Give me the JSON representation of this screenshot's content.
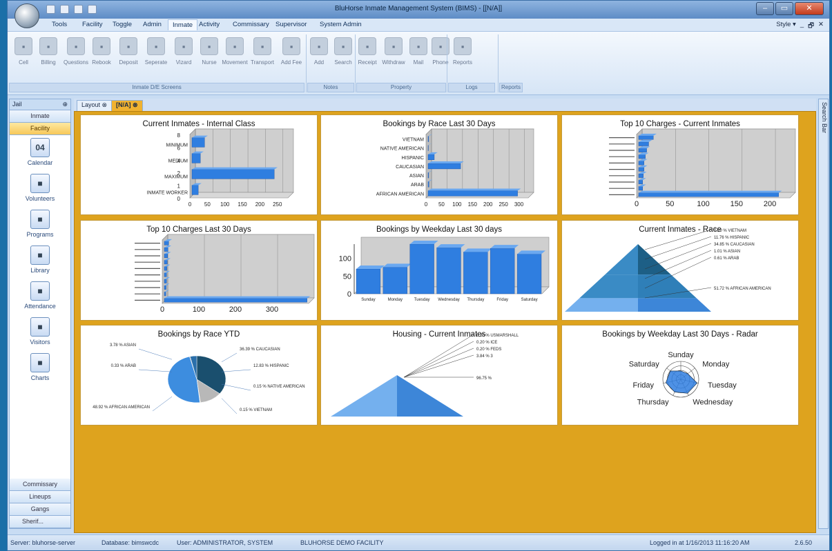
{
  "window": {
    "title": "BluHorse Inmate Management System (BIMS) - [[N/A]]"
  },
  "menu": {
    "items": [
      "Tools",
      "Facility",
      "Toggle",
      "Admin",
      "Inmate",
      "Activity",
      "Commissary",
      "Supervisor",
      "System Admin"
    ],
    "active": "Inmate",
    "style_label": "Style"
  },
  "ribbon": {
    "buttons": [
      {
        "label": "Cell",
        "icon": "cell-icon"
      },
      {
        "label": "Billing",
        "icon": "home-icon"
      },
      {
        "label": "Questions",
        "icon": "pen-icon"
      },
      {
        "label": "Rebook",
        "icon": "rebook-icon"
      },
      {
        "label": "Deposit",
        "icon": "deposit-icon"
      },
      {
        "label": "Seperate",
        "icon": "people-icon"
      },
      {
        "label": "Vizard",
        "icon": "wizard-icon"
      },
      {
        "label": "Nurse",
        "icon": "nurse-icon"
      },
      {
        "label": "Movement",
        "icon": "movement-icon"
      },
      {
        "label": "Transport",
        "icon": "transport-icon"
      },
      {
        "label": "Add Fee",
        "icon": "fee-icon"
      },
      {
        "label": "Add",
        "icon": "note-add-icon"
      },
      {
        "label": "Search",
        "icon": "note-search-icon"
      },
      {
        "label": "Receipt",
        "icon": "receipt-icon"
      },
      {
        "label": "Withdraw",
        "icon": "withdraw-icon"
      },
      {
        "label": "Mail",
        "icon": "mail-icon"
      },
      {
        "label": "Phone",
        "icon": "phone-icon"
      },
      {
        "label": "Reports",
        "icon": "reports-icon"
      }
    ],
    "groups": [
      "Inmate D/E Screens",
      "Notes",
      "Property",
      "Logs",
      "Reports"
    ]
  },
  "sidebar": {
    "header": "Jail",
    "top_nav": [
      "Inmate",
      "Facility"
    ],
    "selected": "Facility",
    "items": [
      {
        "label": "Calendar",
        "icon": "calendar-icon",
        "badge": "04"
      },
      {
        "label": "Volunteers",
        "icon": "volunteers-icon"
      },
      {
        "label": "Programs",
        "icon": "programs-icon"
      },
      {
        "label": "Library",
        "icon": "library-icon"
      },
      {
        "label": "Attendance",
        "icon": "attendance-icon"
      },
      {
        "label": "Visitors",
        "icon": "visitors-icon"
      },
      {
        "label": "Charts",
        "icon": "charts-icon"
      }
    ],
    "bottom_nav": [
      "Commissary",
      "Lineups",
      "Gangs",
      "Sherif..."
    ]
  },
  "tabs": [
    {
      "label": "Layout"
    },
    {
      "label": "[N/A]"
    }
  ],
  "search_bar_label": "Search Bar",
  "status": {
    "server": "Server: bluhorse-server",
    "database": "Database: bimswcdc",
    "user": "User: ADMINISTRATOR, SYSTEM",
    "facility": "BLUHORSE DEMO FACILITY",
    "login": "Logged in at 1/16/2013 11:16:20 AM",
    "version": "2.6.50"
  },
  "colors": {
    "accent": "#dea31e",
    "bar": "#2f7ee0",
    "panel_border": "#c49a3a"
  },
  "chart_data": [
    {
      "type": "bar",
      "orientation": "horizontal",
      "title": "Current Inmates - Internal Class",
      "categories": [
        "MINIMUM",
        "MEDIUM",
        "MAXIMUM",
        "INMATE WORKER"
      ],
      "values": [
        36,
        24,
        235,
        18
      ],
      "xticks": [
        "0",
        "50",
        "100",
        "150",
        "200",
        "250"
      ],
      "yticks": [
        "8",
        "6",
        "4",
        "2",
        "1",
        "0"
      ],
      "xlim": [
        0,
        280
      ]
    },
    {
      "type": "bar",
      "orientation": "horizontal",
      "title": "Bookings by Race Last 30 Days",
      "categories": [
        "VIETNAM",
        "NATIVE AMERICAN",
        "HISPANIC",
        "CAUCASIAN",
        "ASIAN",
        "ARAB",
        "AFRICAN AMERICAN"
      ],
      "values": [
        2,
        1,
        20,
        105,
        2,
        3,
        289
      ],
      "xticks": [
        "0",
        "50",
        "100",
        "150",
        "200",
        "250",
        "300"
      ],
      "xlim": [
        0,
        330
      ]
    },
    {
      "type": "bar",
      "orientation": "horizontal",
      "title": "Top 10 Charges - Current Inmates",
      "categories": [
        "",
        "",
        "",
        "",
        "",
        "",
        "",
        "",
        "",
        ""
      ],
      "values": [
        22,
        15,
        12,
        10,
        8,
        8,
        7,
        6,
        6,
        210
      ],
      "xticks": [
        "0",
        "50",
        "100",
        "150",
        "200"
      ],
      "xlim": [
        0,
        230
      ]
    },
    {
      "type": "bar",
      "orientation": "horizontal",
      "title": "Top 10 Charges Last 30 Days",
      "categories": [
        "",
        "",
        "",
        "",
        "",
        "",
        "",
        "",
        "",
        ""
      ],
      "values": [
        12,
        10,
        9,
        8,
        7,
        6,
        6,
        5,
        4,
        390
      ],
      "xticks": [
        "0",
        "100",
        "200",
        "300"
      ],
      "xlim": [
        0,
        400
      ]
    },
    {
      "type": "bar",
      "title": "Bookings by Weekday Last 30 days",
      "categories": [
        "Sunday",
        "Monday",
        "Tuesday",
        "Wednesday",
        "Thursday",
        "Friday",
        "Saturday"
      ],
      "values": [
        70,
        75,
        140,
        130,
        118,
        128,
        112
      ],
      "yticks": [
        "100",
        "50",
        "0"
      ],
      "ylim": [
        0,
        140
      ]
    },
    {
      "type": "pyramid",
      "title": "Current Inmates - Race",
      "labels": [
        "0.20 % VIETNAM",
        "11.76 % HISPANIC",
        "34.85 % CAUCASIAN",
        "1.01 % ASIAN",
        "0.61 % ARAB",
        "51.72 % AFRICAN AMERICAN"
      ],
      "values": [
        0.2,
        11.76,
        34.85,
        1.01,
        0.61,
        51.72
      ]
    },
    {
      "type": "pie",
      "title": "Bookings by Race YTD",
      "labels": [
        "3.78 % ASIAN",
        "0.33 % ARAB",
        "48.92 % AFRICAN AMERICAN",
        "36.39 % CAUCASIAN",
        "12.83 % HISPANIC",
        "0.15 % NATIVE AMERICAN",
        "0.15 % VIETNAM"
      ],
      "values": [
        3.78,
        0.33,
        48.92,
        36.39,
        12.83,
        0.15,
        0.15
      ]
    },
    {
      "type": "pyramid",
      "title": "Housing - Current Inmates",
      "labels": [
        "0.20 % USMARSHALL",
        "0.20 % ICE",
        "0.20 % FEDS",
        "3.84 % 3",
        "96.75 %"
      ],
      "values": [
        0.2,
        0.2,
        0.2,
        3.84,
        96.75
      ]
    },
    {
      "type": "radar",
      "title": "Bookings by Weekday Last 30 Days - Radar",
      "categories": [
        "Sunday",
        "Monday",
        "Tuesday",
        "Wednesday",
        "Thursday",
        "Friday",
        "Saturday"
      ],
      "values": [
        70,
        75,
        140,
        130,
        118,
        128,
        112
      ]
    }
  ]
}
